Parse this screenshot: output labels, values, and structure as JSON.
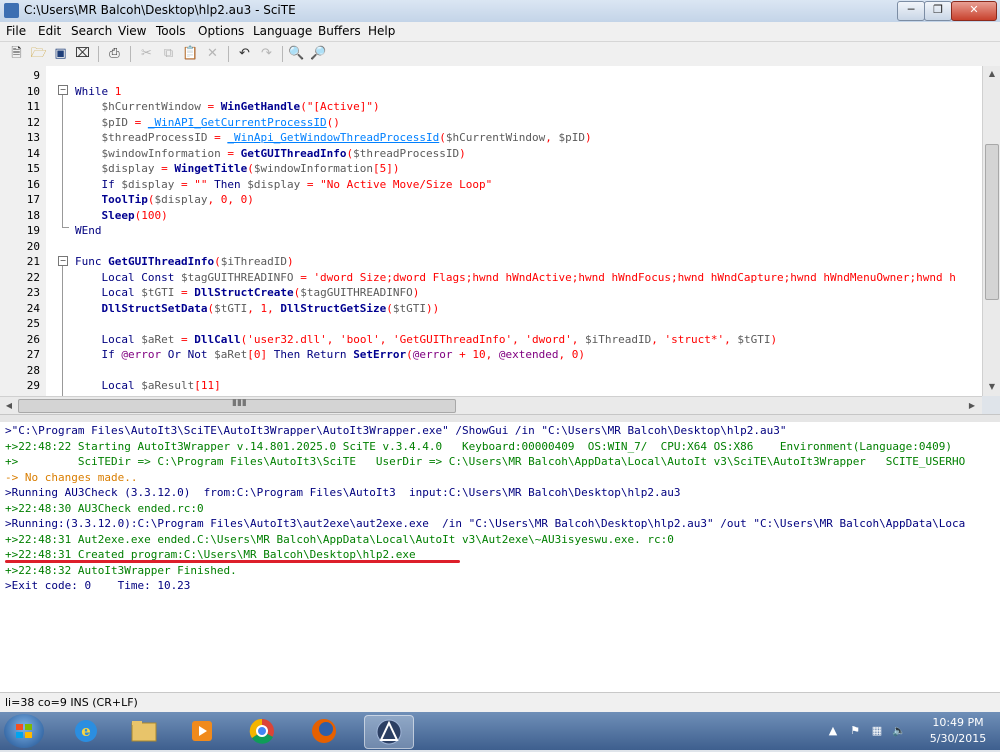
{
  "window": {
    "title": "C:\\Users\\MR Balcoh\\Desktop\\hlp2.au3 - SciTE"
  },
  "menu": [
    "File",
    "Edit",
    "Search",
    "View",
    "Tools",
    "Options",
    "Language",
    "Buffers",
    "Help"
  ],
  "toolbar_icons": [
    "new-file-icon",
    "open-folder-icon",
    "save-icon",
    "close-file-icon",
    "print-icon",
    "cut-icon",
    "copy-icon",
    "paste-icon",
    "delete-icon",
    "undo-icon",
    "redo-icon",
    "find-icon",
    "find-replace-icon"
  ],
  "editor": {
    "line_numbers": [
      "9",
      "10",
      "11",
      "12",
      "13",
      "14",
      "15",
      "16",
      "17",
      "18",
      "19",
      "20",
      "21",
      "22",
      "23",
      "24",
      "25",
      "26",
      "27",
      "28",
      "29"
    ],
    "lines": [
      [],
      [
        [
          "k",
          "While "
        ],
        [
          "n",
          "1"
        ]
      ],
      [
        [
          "v",
          "    $hCurrentWindow "
        ],
        [
          "o",
          "= "
        ],
        [
          "f",
          "WinGetHandle"
        ],
        [
          "o",
          "("
        ],
        [
          "s",
          "\"[Active]\""
        ],
        [
          "o",
          ")"
        ]
      ],
      [
        [
          "v",
          "    $pID "
        ],
        [
          "o",
          "= "
        ],
        [
          "u",
          "_WinAPI_GetCurrentProcessID"
        ],
        [
          "o",
          "()"
        ]
      ],
      [
        [
          "v",
          "    $threadProcessID "
        ],
        [
          "o",
          "= "
        ],
        [
          "u",
          "_WinApi_GetWindowThreadProcessId"
        ],
        [
          "o",
          "("
        ],
        [
          "v",
          "$hCurrentWindow"
        ],
        [
          "o",
          ", "
        ],
        [
          "v",
          "$pID"
        ],
        [
          "o",
          ")"
        ]
      ],
      [
        [
          "v",
          "    $windowInformation "
        ],
        [
          "o",
          "= "
        ],
        [
          "f",
          "GetGUIThreadInfo"
        ],
        [
          "o",
          "("
        ],
        [
          "v",
          "$threadProcessID"
        ],
        [
          "o",
          ")"
        ]
      ],
      [
        [
          "v",
          "    $display "
        ],
        [
          "o",
          "= "
        ],
        [
          "f",
          "WingetTitle"
        ],
        [
          "o",
          "("
        ],
        [
          "v",
          "$windowInformation"
        ],
        [
          "o",
          "["
        ],
        [
          "n",
          "5"
        ],
        [
          "o",
          "])"
        ]
      ],
      [
        [
          "k",
          "    If "
        ],
        [
          "v",
          "$display "
        ],
        [
          "o",
          "= "
        ],
        [
          "s",
          "\"\" "
        ],
        [
          "k",
          "Then "
        ],
        [
          "v",
          "$display "
        ],
        [
          "o",
          "= "
        ],
        [
          "s",
          "\"No Active Move/Size Loop\""
        ]
      ],
      [
        [
          "f",
          "    ToolTip"
        ],
        [
          "o",
          "("
        ],
        [
          "v",
          "$display"
        ],
        [
          "o",
          ", "
        ],
        [
          "n",
          "0"
        ],
        [
          "o",
          ", "
        ],
        [
          "n",
          "0"
        ],
        [
          "o",
          ")"
        ]
      ],
      [
        [
          "f",
          "    Sleep"
        ],
        [
          "o",
          "("
        ],
        [
          "n",
          "100"
        ],
        [
          "o",
          ")"
        ]
      ],
      [
        [
          "k",
          "WEnd"
        ]
      ],
      [],
      [
        [
          "k",
          "Func "
        ],
        [
          "f",
          "GetGUIThreadInfo"
        ],
        [
          "o",
          "("
        ],
        [
          "v",
          "$iThreadID"
        ],
        [
          "o",
          ")"
        ]
      ],
      [
        [
          "k",
          "    Local Const "
        ],
        [
          "v",
          "$tagGUITHREADINFO "
        ],
        [
          "o",
          "= "
        ],
        [
          "s",
          "'dword Size;dword Flags;hwnd hWndActive;hwnd hWndFocus;hwnd hWndCapture;hwnd hWndMenuOwner;hwnd h"
        ]
      ],
      [
        [
          "k",
          "    Local "
        ],
        [
          "v",
          "$tGTI "
        ],
        [
          "o",
          "= "
        ],
        [
          "f",
          "DllStructCreate"
        ],
        [
          "o",
          "("
        ],
        [
          "v",
          "$tagGUITHREADINFO"
        ],
        [
          "o",
          ")"
        ]
      ],
      [
        [
          "f",
          "    DllStructSetData"
        ],
        [
          "o",
          "("
        ],
        [
          "v",
          "$tGTI"
        ],
        [
          "o",
          ", "
        ],
        [
          "n",
          "1"
        ],
        [
          "o",
          ", "
        ],
        [
          "f",
          "DllStructGetSize"
        ],
        [
          "o",
          "("
        ],
        [
          "v",
          "$tGTI"
        ],
        [
          "o",
          "))"
        ]
      ],
      [],
      [
        [
          "k",
          "    Local "
        ],
        [
          "v",
          "$aRet "
        ],
        [
          "o",
          "= "
        ],
        [
          "f",
          "DllCall"
        ],
        [
          "o",
          "("
        ],
        [
          "s",
          "'user32.dll'"
        ],
        [
          "o",
          ", "
        ],
        [
          "s",
          "'bool'"
        ],
        [
          "o",
          ", "
        ],
        [
          "s",
          "'GetGUIThreadInfo'"
        ],
        [
          "o",
          ", "
        ],
        [
          "s",
          "'dword'"
        ],
        [
          "o",
          ", "
        ],
        [
          "v",
          "$iThreadID"
        ],
        [
          "o",
          ", "
        ],
        [
          "s",
          "'struct*'"
        ],
        [
          "o",
          ", "
        ],
        [
          "v",
          "$tGTI"
        ],
        [
          "o",
          ")"
        ]
      ],
      [
        [
          "k",
          "    If "
        ],
        [
          "m",
          "@error "
        ],
        [
          "k",
          "Or Not "
        ],
        [
          "v",
          "$aRet"
        ],
        [
          "o",
          "["
        ],
        [
          "n",
          "0"
        ],
        [
          "o",
          "] "
        ],
        [
          "k",
          "Then Return "
        ],
        [
          "f",
          "SetError"
        ],
        [
          "o",
          "("
        ],
        [
          "m",
          "@error "
        ],
        [
          "o",
          "+ "
        ],
        [
          "n",
          "10"
        ],
        [
          "o",
          ", "
        ],
        [
          "m",
          "@extended"
        ],
        [
          "o",
          ", "
        ],
        [
          "n",
          "0"
        ],
        [
          "o",
          ")"
        ]
      ],
      [],
      [
        [
          "k",
          "    Local "
        ],
        [
          "v",
          "$aResult"
        ],
        [
          "o",
          "["
        ],
        [
          "n",
          "11"
        ],
        [
          "o",
          "]"
        ]
      ]
    ]
  },
  "output": {
    "lines": [
      {
        "c": "#00007f",
        "t": ">\"C:\\Program Files\\AutoIt3\\SciTE\\AutoIt3Wrapper\\AutoIt3Wrapper.exe\" /ShowGui /in \"C:\\Users\\MR Balcoh\\Desktop\\hlp2.au3\""
      },
      {
        "c": "#007f00",
        "t": "+>22:48:22 Starting AutoIt3Wrapper v.14.801.2025.0 SciTE v.3.4.4.0   Keyboard:00000409  OS:WIN_7/  CPU:X64 OS:X86    Environment(Language:0409)"
      },
      {
        "c": "#007f00",
        "t": "+>         SciTEDir => C:\\Program Files\\AutoIt3\\SciTE   UserDir => C:\\Users\\MR Balcoh\\AppData\\Local\\AutoIt v3\\SciTE\\AutoIt3Wrapper   SCITE_USERHO"
      },
      {
        "c": "#d97d00",
        "t": "-> No changes made.."
      },
      {
        "c": "#00007f",
        "t": ">Running AU3Check (3.3.12.0)  from:C:\\Program Files\\AutoIt3  input:C:\\Users\\MR Balcoh\\Desktop\\hlp2.au3"
      },
      {
        "c": "#007f00",
        "t": "+>22:48:30 AU3Check ended.rc:0"
      },
      {
        "c": "#00007f",
        "t": ">Running:(3.3.12.0):C:\\Program Files\\AutoIt3\\aut2exe\\aut2exe.exe  /in \"C:\\Users\\MR Balcoh\\Desktop\\hlp2.au3\" /out \"C:\\Users\\MR Balcoh\\AppData\\Loca"
      },
      {
        "c": "#007f00",
        "t": "+>22:48:31 Aut2exe.exe ended.C:\\Users\\MR Balcoh\\AppData\\Local\\AutoIt v3\\Aut2exe\\~AU3isyeswu.exe. rc:0"
      },
      {
        "c": "#007f00",
        "t": "+>22:48:31 Created program:C:\\Users\\MR Balcoh\\Desktop\\hlp2.exe"
      },
      {
        "c": "#007f00",
        "t": "+>22:48:32 AutoIt3Wrapper Finished."
      },
      {
        "c": "#00007f",
        "t": ">Exit code: 0    Time: 10.23"
      }
    ]
  },
  "statusbar": {
    "text": "li=38 co=9 INS (CR+LF)"
  },
  "taskbar": {
    "time": "10:49 PM",
    "date": "5/30/2015"
  },
  "colors": {
    "k": "#00007f",
    "v": "#5a5a5a",
    "f": "#000090",
    "u": "#0080ff",
    "s": "#ff0000",
    "n": "#ff0000",
    "o": "#ff0000",
    "m": "#800080"
  }
}
